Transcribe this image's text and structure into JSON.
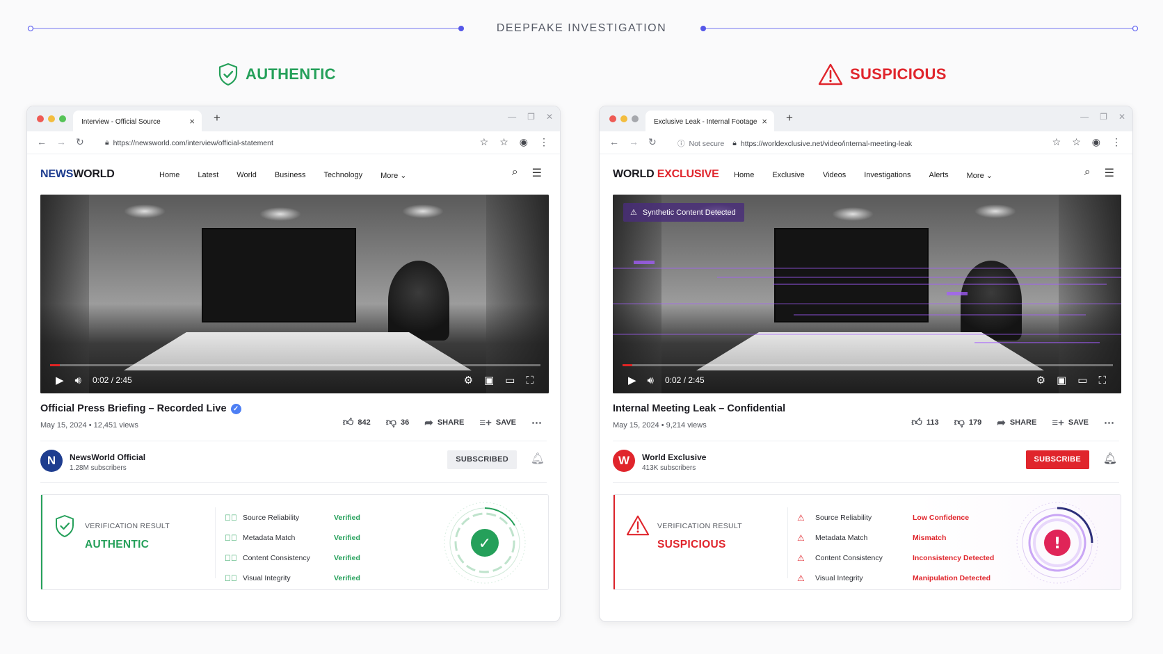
{
  "header": {
    "title": "DEEPFAKE INVESTIGATION"
  },
  "colors": {
    "authentic": "#25a05a",
    "suspicious": "#e0252c",
    "accent_line": "#6d6ff0",
    "glitch_purple": "#a45cff"
  },
  "left": {
    "verdict": "AUTHENTIC",
    "verdict_icon": "shield-check-icon",
    "tab_title": "Interview - Official Source",
    "url": "https://newsworld.com/interview/official-statement",
    "logo_part1": "NEWS",
    "logo_part2": "WORLD",
    "menu": [
      "Home",
      "Latest",
      "World",
      "Business",
      "Technology",
      "More ⌄"
    ],
    "player": {
      "time": "0:02 / 2:45",
      "progress": 0.02
    },
    "video_title": "Official Press Briefing – Recorded Live",
    "meta": "May 15, 2024  •  12,451 views",
    "likes": "842",
    "dislikes": "36",
    "share": "SHARE",
    "save": "SAVE",
    "channel": {
      "avatar": "N",
      "name": "NewsWorld Official",
      "subs": "1.28M subscribers",
      "button": "SUBSCRIBED"
    },
    "verification": {
      "label": "VERIFICATION RESULT",
      "result": "AUTHENTIC",
      "checks": [
        {
          "name": "Source Reliability",
          "status": "Verified"
        },
        {
          "name": "Metadata Match",
          "status": "Verified"
        },
        {
          "name": "Content Consistency",
          "status": "Verified"
        },
        {
          "name": "Visual Integrity",
          "status": "Verified"
        }
      ],
      "gauge_symbol": "✓"
    }
  },
  "right": {
    "verdict": "SUSPICIOUS",
    "verdict_icon": "warning-triangle-icon",
    "tab_title": "Exclusive Leak - Internal Footage",
    "not_secure": "Not secure",
    "url": "https://worldexclusive.net/video/internal-meeting-leak",
    "logo_part1": "WORLD ",
    "logo_part2": "EXCLUSIVE",
    "menu": [
      "Home",
      "Exclusive",
      "Videos",
      "Investigations",
      "Alerts",
      "More ⌄"
    ],
    "player": {
      "time": "0:02 / 2:45",
      "progress": 0.02
    },
    "overlay_badge": "Synthetic Content Detected",
    "video_title": "Internal Meeting Leak – Confidential",
    "meta": "May 15, 2024  •  9,214 views",
    "likes": "113",
    "dislikes": "179",
    "share": "SHARE",
    "save": "SAVE",
    "channel": {
      "avatar": "W",
      "name": "World Exclusive",
      "subs": "413K subscribers",
      "button": "SUBSCRIBE"
    },
    "verification": {
      "label": "VERIFICATION RESULT",
      "result": "SUSPICIOUS",
      "checks": [
        {
          "name": "Source Reliability",
          "status": "Low Confidence"
        },
        {
          "name": "Metadata Match",
          "status": "Mismatch"
        },
        {
          "name": "Content Consistency",
          "status": "Inconsistency Detected"
        },
        {
          "name": "Visual Integrity",
          "status": "Manipulation Detected"
        }
      ],
      "gauge_symbol": "!"
    }
  }
}
